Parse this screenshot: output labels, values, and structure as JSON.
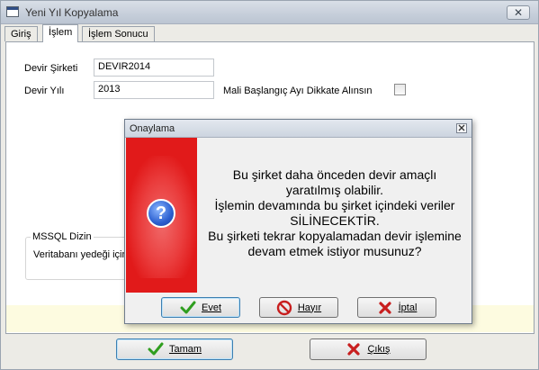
{
  "window": {
    "title": "Yeni Yıl Kopyalama",
    "close_glyph": "✕"
  },
  "tabs": [
    {
      "label": "Giriş",
      "active": false
    },
    {
      "label": "İşlem",
      "active": true
    },
    {
      "label": "İşlem Sonucu",
      "active": false
    }
  ],
  "form": {
    "devir_sirketi_label": "Devir Şirketi",
    "devir_sirketi_value": "DEVIR2014",
    "devir_yili_label": "Devir Yılı",
    "devir_yili_value": "2013",
    "mali_label": "Mali Başlangıç Ayı Dikkate Alınsın",
    "mali_checked": false,
    "group_title": "MSSQL Dizin",
    "group_text": "Veritabanı yedeği için"
  },
  "footer_buttons": {
    "ok_label": "Tamam",
    "exit_label": "Çıkış"
  },
  "dialog": {
    "title": "Onaylama",
    "icon": "question-icon",
    "message_lines": [
      "Bu şirket daha önceden devir amaçlı",
      "yaratılmış olabilir.",
      "İşlemin devamında bu şirket içindeki veriler",
      "SİLİNECEKTİR.",
      "Bu şirketi tekrar kopyalamadan devir işlemine",
      "devam etmek istiyor musunuz?"
    ],
    "yes_label": "Evet",
    "no_label": "Hayır",
    "cancel_label": "İptal"
  },
  "colors": {
    "dialog_accent": "#e11a1a",
    "check_green": "#2f9e1f",
    "x_red": "#c81e1e",
    "info_strip": "#fdfbe0"
  }
}
